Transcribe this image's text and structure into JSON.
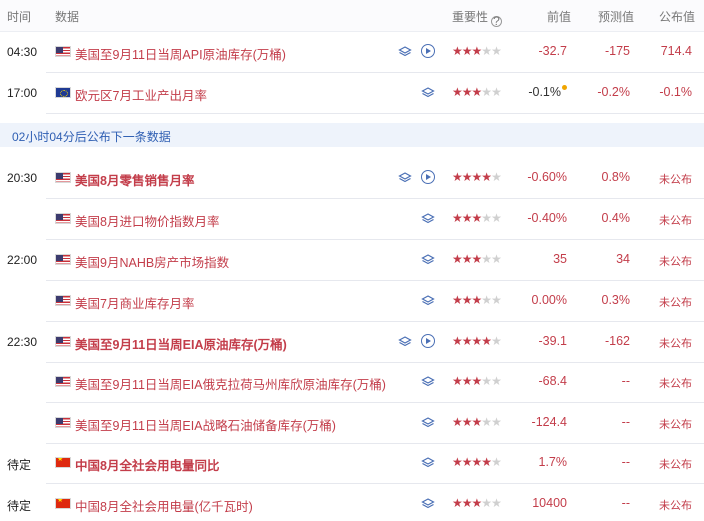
{
  "header": {
    "time": "时间",
    "data": "数据",
    "importance": "重要性",
    "previous": "前值",
    "forecast": "预测值",
    "actual": "公布值"
  },
  "banner": "02小时04分后公布下一条数据",
  "colors": {
    "accent_red": "#c33d4a",
    "banner_blue": "#2f5fb3",
    "dot_orange": "#f0a500"
  },
  "rows": [
    {
      "time": "04:30",
      "flag": "us",
      "name": "美国至9月11日当周API原油库存(万桶)",
      "bold": false,
      "icons": [
        "layers-icon",
        "play-icon"
      ],
      "stars": 3,
      "previous": "-32.7",
      "forecast": "-175",
      "actual": "714.4"
    },
    {
      "time": "17:00",
      "flag": "eu",
      "name": "欧元区7月工业产出月率",
      "bold": false,
      "icons": [
        "layers-icon"
      ],
      "stars": 3,
      "previous": "-0.1%",
      "forecast": "-0.2%",
      "actual": "-0.1%"
    },
    {
      "time": "20:30",
      "flag": "us",
      "name": "美国8月零售销售月率",
      "bold": true,
      "icons": [
        "layers-icon",
        "play-icon"
      ],
      "stars": 4,
      "previous": "-0.60%",
      "forecast": "0.8%",
      "actual": "未公布"
    },
    {
      "time": "",
      "flag": "us",
      "name": "美国8月进口物价指数月率",
      "bold": false,
      "icons": [
        "layers-icon"
      ],
      "stars": 3,
      "previous": "-0.40%",
      "forecast": "0.4%",
      "actual": "未公布"
    },
    {
      "time": "22:00",
      "flag": "us",
      "name": "美国9月NAHB房产市场指数",
      "bold": false,
      "icons": [
        "layers-icon"
      ],
      "stars": 3,
      "previous": "35",
      "forecast": "34",
      "actual": "未公布"
    },
    {
      "time": "",
      "flag": "us",
      "name": "美国7月商业库存月率",
      "bold": false,
      "icons": [
        "layers-icon"
      ],
      "stars": 3,
      "previous": "0.00%",
      "forecast": "0.3%",
      "actual": "未公布"
    },
    {
      "time": "22:30",
      "flag": "us",
      "name": "美国至9月11日当周EIA原油库存(万桶)",
      "bold": true,
      "icons": [
        "layers-icon",
        "play-icon"
      ],
      "stars": 4,
      "previous": "-39.1",
      "forecast": "-162",
      "actual": "未公布"
    },
    {
      "time": "",
      "flag": "us",
      "name": "美国至9月11日当周EIA俄克拉荷马州库欣原油库存(万桶)",
      "bold": false,
      "icons": [
        "layers-icon"
      ],
      "stars": 3,
      "previous": "-68.4",
      "forecast": "--",
      "actual": "未公布"
    },
    {
      "time": "",
      "flag": "us",
      "name": "美国至9月11日当周EIA战略石油储备库存(万桶)",
      "bold": false,
      "icons": [
        "layers-icon"
      ],
      "stars": 3,
      "previous": "-124.4",
      "forecast": "--",
      "actual": "未公布"
    },
    {
      "time": "待定",
      "flag": "cn",
      "name": "中国8月全社会用电量同比",
      "bold": true,
      "icons": [
        "layers-icon"
      ],
      "stars": 4,
      "previous": "1.7%",
      "forecast": "--",
      "actual": "未公布"
    },
    {
      "time": "待定",
      "flag": "cn",
      "name": "中国8月全社会用电量(亿千瓦时)",
      "bold": false,
      "icons": [
        "layers-icon"
      ],
      "stars": 3,
      "previous": "10400",
      "forecast": "--",
      "actual": "未公布"
    }
  ]
}
